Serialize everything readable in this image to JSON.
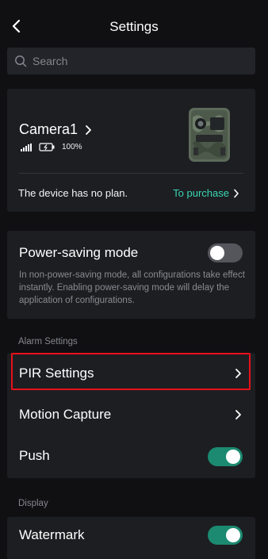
{
  "header": {
    "title": "Settings"
  },
  "search": {
    "placeholder": "Search"
  },
  "device": {
    "name": "Camera1",
    "battery": "100%",
    "plan_text": "The device has no plan.",
    "purchase_label": "To purchase"
  },
  "power_saving": {
    "label": "Power-saving mode",
    "description": "In non-power-saving mode, all configurations take effect instantly. Enabling power-saving mode will delay the application of configurations.",
    "enabled": false
  },
  "alarm_section": {
    "label": "Alarm Settings",
    "items": [
      {
        "label": "PIR Settings",
        "control": "chevron"
      },
      {
        "label": "Motion Capture",
        "control": "chevron"
      },
      {
        "label": "Push",
        "control": "toggle",
        "enabled": true
      }
    ]
  },
  "display_section": {
    "label": "Display",
    "items": [
      {
        "label": "Watermark",
        "control": "toggle",
        "enabled": true
      }
    ]
  },
  "colors": {
    "accent": "#38d6b2",
    "toggle_on": "#1b8a70",
    "highlight": "#e8101a"
  }
}
